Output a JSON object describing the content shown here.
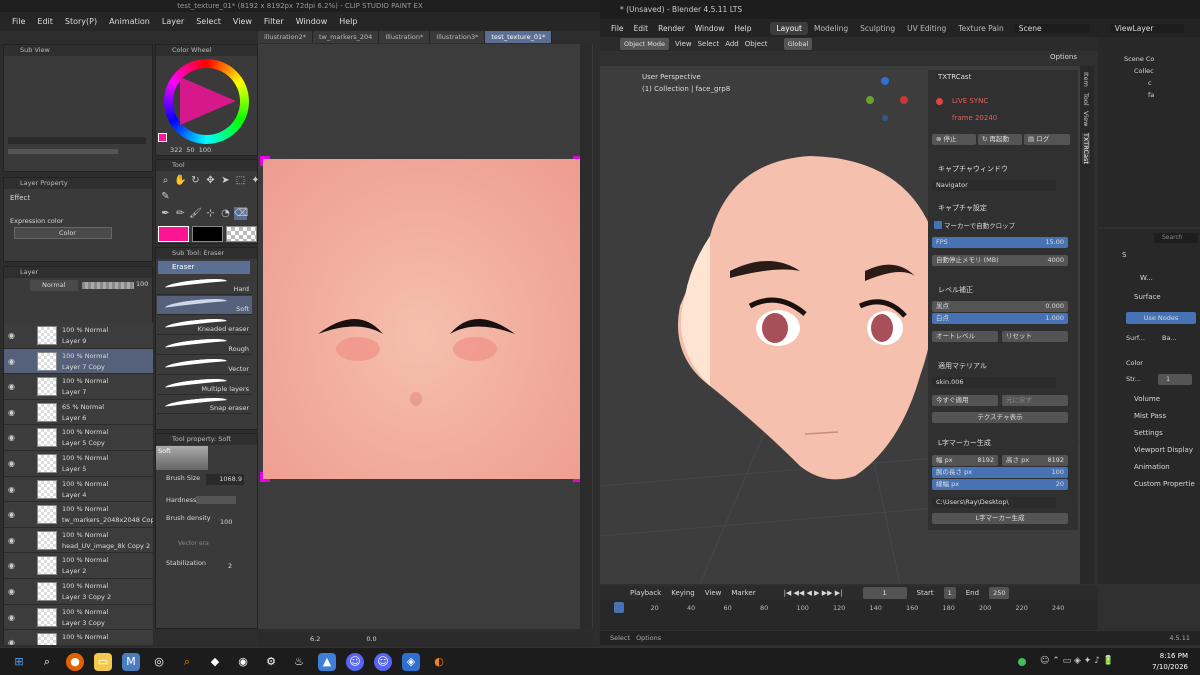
{
  "csp": {
    "title": "test_texture_01* (8192 x 8192px 72dpi 6.2%)  - CLIP STUDIO PAINT EX",
    "menu": [
      "File",
      "Edit",
      "Story(P)",
      "Animation",
      "Layer",
      "Select",
      "View",
      "Filter",
      "Window",
      "Help"
    ],
    "doc_tabs": [
      "illustration2*",
      "tw_markers_204",
      "Illustration*",
      "Illustration3*",
      "test_texture_01*"
    ],
    "active_doc_tab": "test_texture_01*",
    "panels": {
      "sub_view": "Sub View",
      "color_wheel": "Color Wheel",
      "color_values": {
        "h": "322",
        "s": "50",
        "v": "100"
      },
      "tool": "Tool",
      "sub_tool": "Sub Tool: Eraser",
      "sub_tool_group": "Eraser",
      "layer_property": "Layer Property",
      "effect_label": "Effect",
      "expression_color_label": "Expression color",
      "expression_color_value": "Color",
      "layer": "Layer",
      "blend_mode": "Normal",
      "opacity": "100",
      "tool_property": "Tool property: Soft",
      "tool_property_preset": "Soft"
    },
    "brushes": [
      {
        "label": "Hard"
      },
      {
        "label": "Soft"
      },
      {
        "label": "Kneaded eraser"
      },
      {
        "label": "Rough"
      },
      {
        "label": "Vector"
      },
      {
        "label": "Multiple layers"
      },
      {
        "label": "Snap eraser"
      }
    ],
    "tool_props": {
      "brush_size_label": "Brush Size",
      "brush_size_value": "1068.9",
      "hardness_label": "Hardness",
      "brush_density_label": "Brush density",
      "brush_density_value": "100",
      "vector_eraser_label": "Vector era",
      "stabilization_label": "Stabilization",
      "stabilization_value": "2"
    },
    "layers": [
      {
        "line1": "100 % Normal",
        "line2": "Layer 9",
        "selected": false
      },
      {
        "line1": "100 % Normal",
        "line2": "Layer 7 Copy",
        "selected": true
      },
      {
        "line1": "100 % Normal",
        "line2": "Layer 7",
        "selected": false
      },
      {
        "line1": "65 % Normal",
        "line2": "Layer 6",
        "selected": false
      },
      {
        "line1": "100 % Normal",
        "line2": "Layer 5 Copy",
        "selected": false
      },
      {
        "line1": "100 % Normal",
        "line2": "Layer 5",
        "selected": false
      },
      {
        "line1": "100 % Normal",
        "line2": "Layer 4",
        "selected": false
      },
      {
        "line1": "100 % Normal",
        "line2": "tw_markers_2048x2048 Copy",
        "selected": false
      },
      {
        "line1": "100 % Normal",
        "line2": "head_UV_image_8k Copy 2",
        "selected": false
      },
      {
        "line1": "100 % Normal",
        "line2": "Layer 2",
        "selected": false
      },
      {
        "line1": "100 % Normal",
        "line2": "Layer 3 Copy 2",
        "selected": false
      },
      {
        "line1": "100 % Normal",
        "line2": "Layer 3 Copy",
        "selected": false
      },
      {
        "line1": "100 % Normal",
        "line2": ""
      }
    ],
    "status": {
      "zoom": "6.2",
      "angle": "0.0"
    },
    "colors": {
      "main": "#ff1493",
      "sub": "#000000",
      "accent": "#e600e6"
    }
  },
  "blender": {
    "title": "* (Unsaved) - Blender 4.5.11 LTS",
    "menu": [
      "File",
      "Edit",
      "Render",
      "Window",
      "Help"
    ],
    "workspaces": [
      "Layout",
      "Modeling",
      "Sculpting",
      "UV Editing",
      "Texture Pain"
    ],
    "active_workspace": "Layout",
    "scene": "Scene",
    "view_layer": "ViewLayer",
    "header": {
      "mode": "Object Mode",
      "view": "View",
      "select": "Select",
      "add": "Add",
      "object": "Object",
      "orientation": "Global",
      "options": "Options"
    },
    "viewport": {
      "perspective": "User Perspective",
      "collection": "(1) Collection | face_grp8"
    },
    "side_tabs": [
      "Item",
      "Tool",
      "View",
      "TXTRCast"
    ],
    "txtr": {
      "title": "TXTRCast",
      "live_sync": "LIVE SYNC",
      "frame": "frame  20240",
      "stop": "停止",
      "restart": "再起動",
      "log": "ログ",
      "capture_window_header": "キャプチャウィンドウ",
      "capture_window_value": "Navigator",
      "capture_settings_header": "キャプチャ設定",
      "auto_crop_label": "マーカーで自動クロップ",
      "fps_label": "FPS",
      "fps_value": "15.00",
      "auto_stop_label": "自動停止メモリ (MB)",
      "auto_stop_value": "4000",
      "level_header": "レベル補正",
      "black_label": "黒点",
      "black_value": "0.000",
      "white_label": "白点",
      "white_value": "1.000",
      "auto_level": "オートレベル",
      "reset": "リセット",
      "material_header": "適用マテリアル",
      "material_value": "skin.006",
      "apply_now": "今すぐ適用",
      "revert": "元に戻す",
      "show_texture": "テクスチャ表示",
      "marker_header": "L字マーカー生成",
      "width_label": "幅 px",
      "width_value": "8192",
      "height_label": "高さ px",
      "height_value": "8192",
      "arm_label": "腕の長さ px",
      "arm_value": "100",
      "line_label": "線幅 px",
      "line_value": "20",
      "path": "C:\\Users\\Ray\\Desktop\\",
      "generate": "L字マーカー生成"
    },
    "outliner": {
      "root": "Scene Co",
      "collection": "Collec",
      "items": [
        "c",
        "fa"
      ]
    },
    "properties": {
      "search_placeholder": "Search",
      "object_label": "S",
      "material_label": "W...",
      "sections": [
        "Surface",
        "Volume",
        "Mist Pass",
        "Settings",
        "Viewport Display",
        "Animation",
        "Custom Propertie"
      ],
      "use_nodes": "Use Nodes",
      "surface_label": "Surf...",
      "surface_value": "Ba...",
      "color_label": "Color",
      "strength_label": "Str...",
      "strength_value": "1"
    },
    "timeline": {
      "playback": "Playback",
      "keying": "Keying",
      "view": "View",
      "marker": "Marker",
      "current_frame": "1",
      "start_label": "Start",
      "start_value": "1",
      "end_label": "End",
      "end_value": "250",
      "ticks": [
        "1",
        "20",
        "40",
        "60",
        "80",
        "100",
        "120",
        "140",
        "160",
        "180",
        "200",
        "220",
        "240"
      ]
    },
    "status": {
      "select": "Select",
      "options": "Options",
      "version": "4.5.11"
    }
  },
  "taskbar": {
    "time": "8:16 PM",
    "date": "7/10/2026"
  }
}
